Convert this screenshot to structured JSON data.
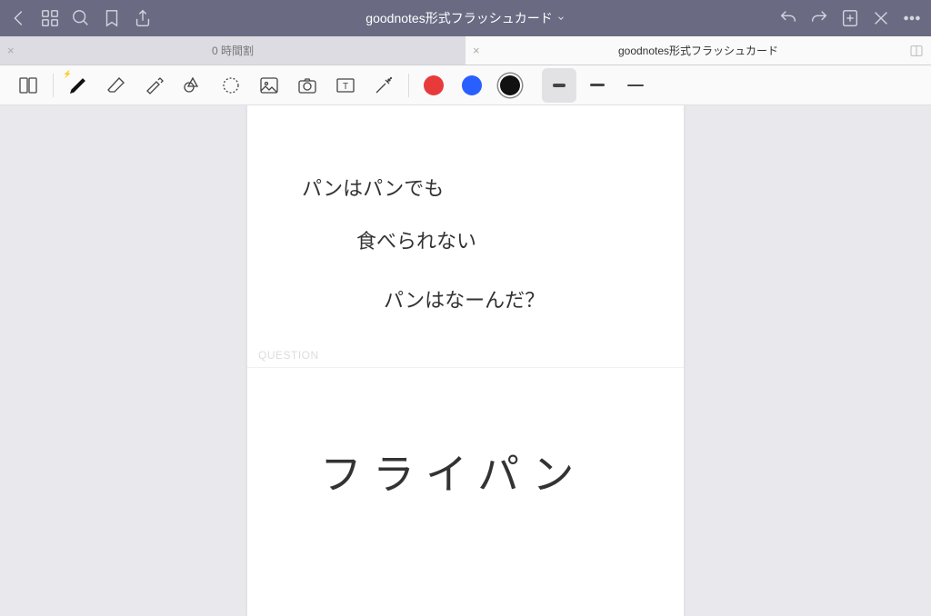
{
  "titlebar": {
    "document_title": "goodnotes形式フラッシュカード"
  },
  "tabs": {
    "inactive_label": "0 時間割",
    "active_label": "goodnotes形式フラッシュカード"
  },
  "tools": {
    "nav_back": "back",
    "grid": "grid",
    "search": "search",
    "bookmark": "bookmark",
    "share": "share",
    "undo": "undo",
    "redo": "redo",
    "add_page": "add-page",
    "close_doc": "close",
    "more": "more"
  },
  "toolbar": {
    "outline": "outline",
    "pen": "pen",
    "eraser": "eraser",
    "highlighter": "highlighter",
    "shapes": "shapes",
    "lasso": "lasso",
    "image": "image",
    "camera": "camera",
    "text": "text",
    "laser": "laser"
  },
  "colors": {
    "c1": "#e83a3a",
    "c2": "#2a5fff",
    "c3": "#111111"
  },
  "strokes": {
    "s1_w": 14,
    "s1_h": 4,
    "s2_w": 16,
    "s2_h": 3,
    "s3_w": 18,
    "s3_h": 2
  },
  "flashcard": {
    "q_line1": "パンはパンでも",
    "q_line2": "食べられない",
    "q_line3": "パンはなーんだ？",
    "question_label": "QUESTION",
    "answer": "フライパン"
  }
}
